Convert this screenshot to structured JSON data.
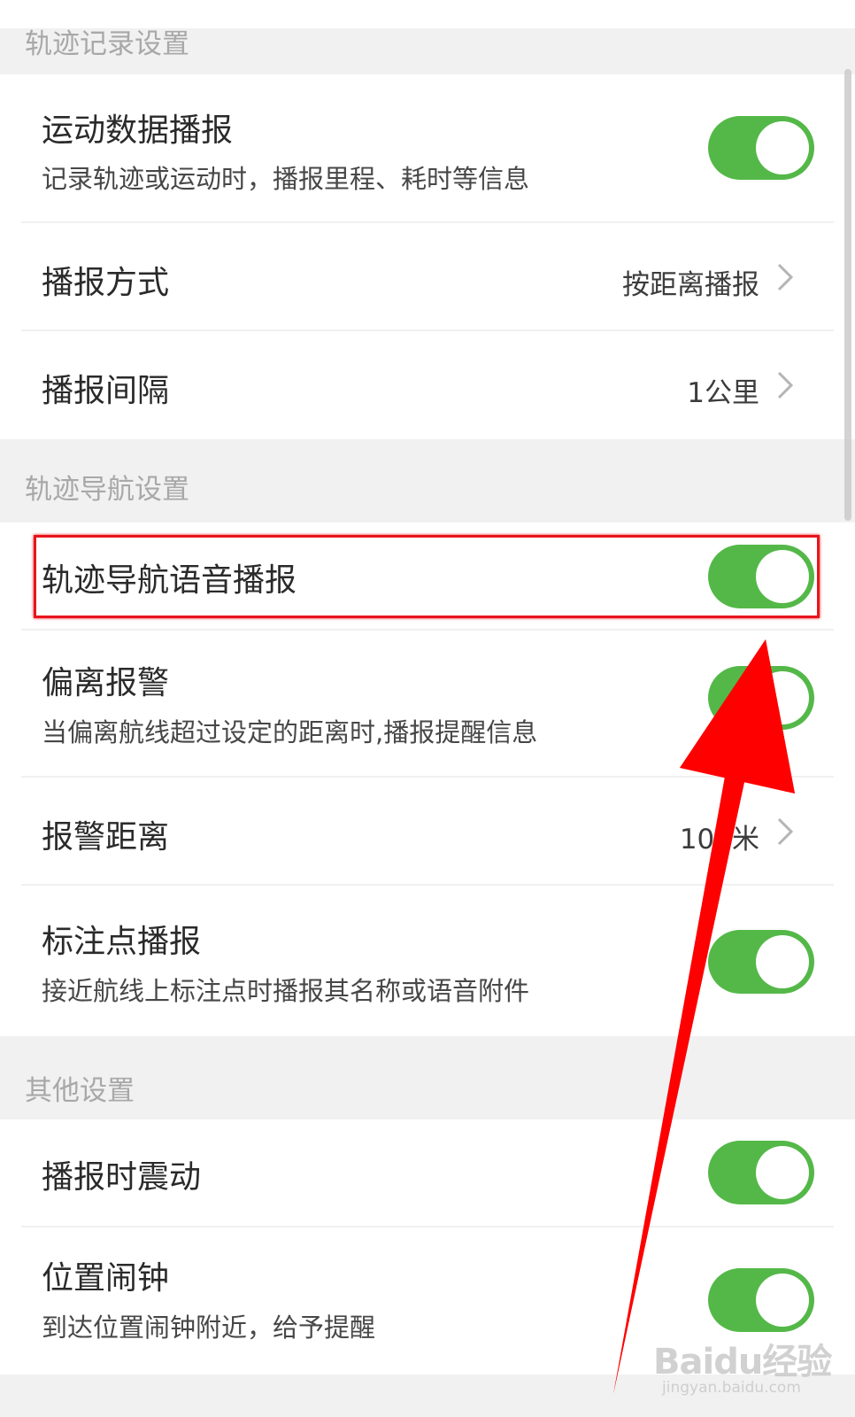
{
  "sections": {
    "track_record": "轨迹记录设置",
    "track_nav": "轨迹导航设置",
    "other": "其他设置"
  },
  "rows": {
    "sport_broadcast": {
      "title": "运动数据播报",
      "desc": "记录轨迹或运动时，播报里程、耗时等信息",
      "toggle_on": true
    },
    "broadcast_mode": {
      "title": "播报方式",
      "value": "按距离播报"
    },
    "broadcast_interval": {
      "title": "播报间隔",
      "value": "1公里"
    },
    "nav_voice": {
      "title": "轨迹导航语音播报",
      "toggle_on": true
    },
    "deviation_alert": {
      "title": "偏离报警",
      "desc": "当偏离航线超过设定的距离时,播报提醒信息",
      "toggle_on": true
    },
    "alert_distance": {
      "title": "报警距离",
      "value": "100米"
    },
    "marker_broadcast": {
      "title": "标注点播报",
      "desc": "接近航线上标注点时播报其名称或语音附件",
      "toggle_on": true
    },
    "vibrate": {
      "title": "播报时震动",
      "toggle_on": true
    },
    "location_alarm": {
      "title": "位置闹钟",
      "desc": "到达位置闹钟附近，给予提醒",
      "toggle_on": true
    }
  },
  "watermark": {
    "logo": "Baidu经验",
    "sub": "jingyan.baidu.com"
  },
  "colors": {
    "toggle_on": "#54b848",
    "highlight": "#e8141c",
    "arrow": "#ff0000"
  }
}
